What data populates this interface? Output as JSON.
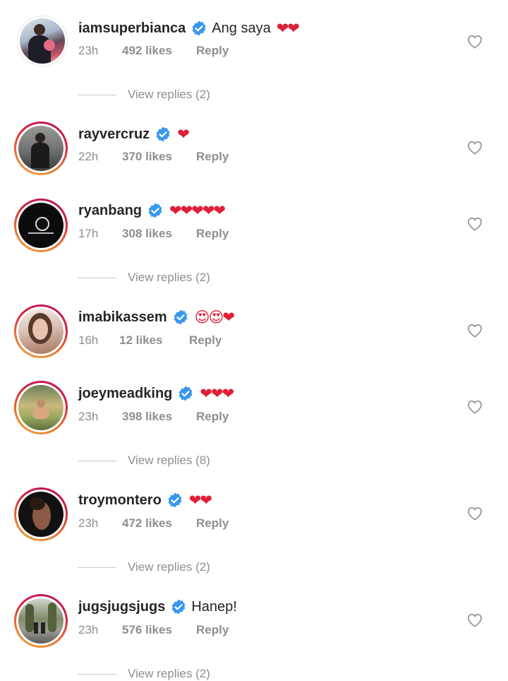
{
  "comments": [
    {
      "username": "iamsuperbianca",
      "text": "Ang saya",
      "emoji": "❤❤",
      "time": "23h",
      "likes": "492 likes",
      "reply": "Reply",
      "view_replies": "View replies (2)"
    },
    {
      "username": "rayvercruz",
      "text": "",
      "emoji": "❤",
      "time": "22h",
      "likes": "370 likes",
      "reply": "Reply",
      "view_replies": ""
    },
    {
      "username": "ryanbang",
      "text": "",
      "emoji": "❤❤❤❤❤",
      "time": "17h",
      "likes": "308 likes",
      "reply": "Reply",
      "view_replies": "View replies (2)"
    },
    {
      "username": "imabikassem",
      "text": "",
      "emoji": "😍😍❤",
      "time": "16h",
      "likes": "12 likes",
      "reply": "Reply",
      "view_replies": ""
    },
    {
      "username": "joeymeadking",
      "text": "",
      "emoji": "❤❤❤",
      "time": "23h",
      "likes": "398 likes",
      "reply": "Reply",
      "view_replies": "View replies (8)"
    },
    {
      "username": "troymontero",
      "text": "",
      "emoji": "❤❤",
      "time": "23h",
      "likes": "472 likes",
      "reply": "Reply",
      "view_replies": "View replies (2)"
    },
    {
      "username": "jugsjugsjugs",
      "text": "Hanep!",
      "emoji": "",
      "time": "23h",
      "likes": "576 likes",
      "reply": "Reply",
      "view_replies": "View replies (2)"
    }
  ],
  "icons": {
    "verified": "verified-badge-icon",
    "like": "heart-outline-icon"
  },
  "colors": {
    "verified": "#3897f0",
    "username": "#262626",
    "meta": "#8e8e8e",
    "heart_emoji": "#e01e35",
    "story_ring_start": "#b5135f",
    "story_ring_end": "#f1a93d"
  }
}
